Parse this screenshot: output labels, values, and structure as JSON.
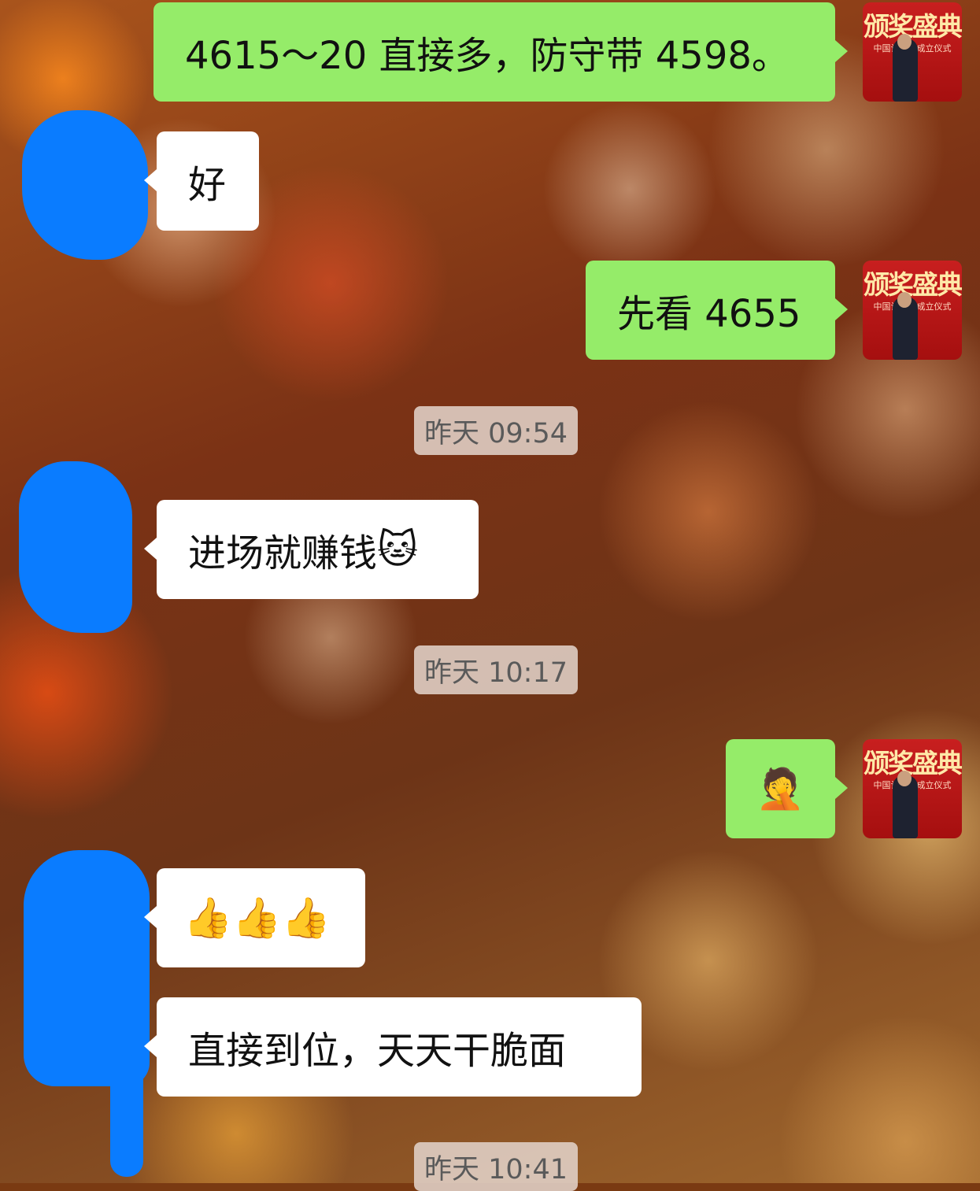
{
  "chat": {
    "messages": [
      {
        "side": "self",
        "text": "4615～20 直接多，防守带 4598。"
      },
      {
        "side": "other",
        "text": "好"
      },
      {
        "side": "self",
        "text": "先看 4655"
      },
      {
        "side": "other",
        "text": "进场就赚钱",
        "emoji": "🐱"
      },
      {
        "side": "self",
        "emoji": "🤦"
      },
      {
        "side": "other",
        "emoji": "👍👍👍"
      },
      {
        "side": "other",
        "text": "直接到位，天天干脆面"
      }
    ],
    "timestamps": [
      "昨天 09:54",
      "昨天 10:17",
      "昨天 10:41"
    ]
  },
  "self_avatar": {
    "title_text": "颁奖盛典",
    "subtitle_text": "中国计协会成立仪式"
  },
  "colors": {
    "self_bubble": "#95ec69",
    "other_bubble": "#ffffff",
    "privacy_scribble": "#0a7cff"
  }
}
